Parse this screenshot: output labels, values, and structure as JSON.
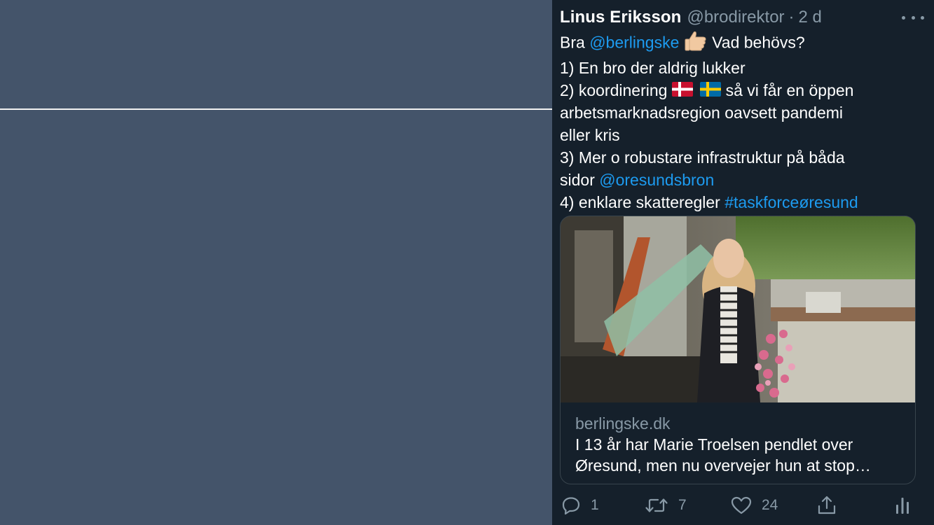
{
  "tweet": {
    "author": {
      "display_name": "Linus Eriksson",
      "handle": "@brodirektor",
      "separator": "·",
      "time": "2 d"
    },
    "text": {
      "l1": {
        "pre": "Bra ",
        "mention": "@berlingske",
        "emoji": "thumbs-up",
        "post": "Vad behövs?"
      },
      "l2": "1) En bro der aldrig lukker",
      "l3": {
        "pre": "2) koordinering ",
        "flags": [
          "denmark-flag",
          "sweden-flag"
        ],
        "post": " så vi får en öppen"
      },
      "l4": "arbetsmarknadsregion oavsett pandemi",
      "l5": "eller kris",
      "l6": "3) Mer o robustare infrastruktur på båda",
      "l7": {
        "pre": "sidor ",
        "mention": "@oresundsbron"
      },
      "l8": {
        "pre": "4) enklare skatteregler ",
        "hashtag": "#taskforceøresund"
      }
    },
    "card": {
      "domain": "berlingske.dk",
      "title_line1": "I 13 år har Marie Troelsen pendlet over",
      "title_line2": "Øresund, men nu overvejer hun at stop…"
    },
    "actions": {
      "replies": "1",
      "retweets": "7",
      "likes": "24"
    }
  },
  "icons": [
    "more-icon",
    "reply-icon",
    "retweet-icon",
    "like-icon",
    "share-icon",
    "analytics-icon"
  ],
  "colors": {
    "background_left": "#44546a",
    "tweet_bg": "#15202b",
    "link": "#1d9bf0",
    "muted": "#8899a6",
    "text": "#ffffff"
  }
}
